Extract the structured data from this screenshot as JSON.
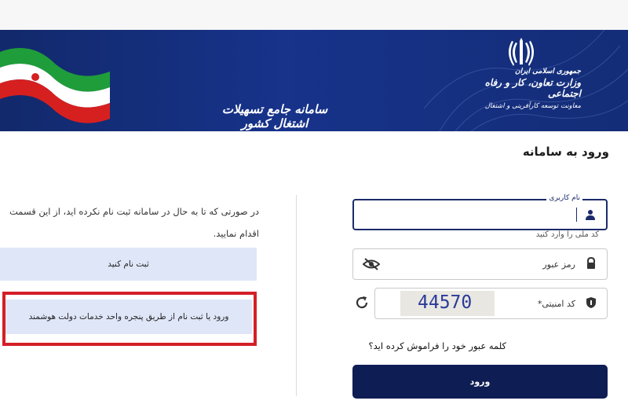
{
  "header": {
    "system_title": "سامانه جامع تسهیلات اشتغال کشور",
    "ministry_line1": "جمهوری اسلامی ایران",
    "ministry_line2": "وزارت تعاون، کار و رفاه اجتماعی",
    "ministry_line3": "معاونت توسعه کارآفرینی و اشتغال"
  },
  "login": {
    "title": "ورود به سامانه",
    "username_label": "نام کاربری",
    "username_value": "",
    "username_hint": "کد ملی را وارد کنید",
    "password_placeholder": "رمز عبور",
    "captcha_label": "کد امنیتی*",
    "captcha_text": "44570",
    "forgot_link": "کلمه عبور خود را فراموش کرده اید؟",
    "submit_label": "ورود"
  },
  "register": {
    "info_text": "در صورتی که تا به حال در سامانه ثبت نام نکرده اید، از این قسمت اقدام نمایید.",
    "register_button": "ثبت نام کنید",
    "sso_button": "ورود یا ثبت نام از طریق پنجره واحد خدمات دولت هوشمند"
  },
  "colors": {
    "banner": "#17338a",
    "primary": "#0f1d55",
    "button_light": "#dfe6f8",
    "highlight": "#d41f27"
  }
}
